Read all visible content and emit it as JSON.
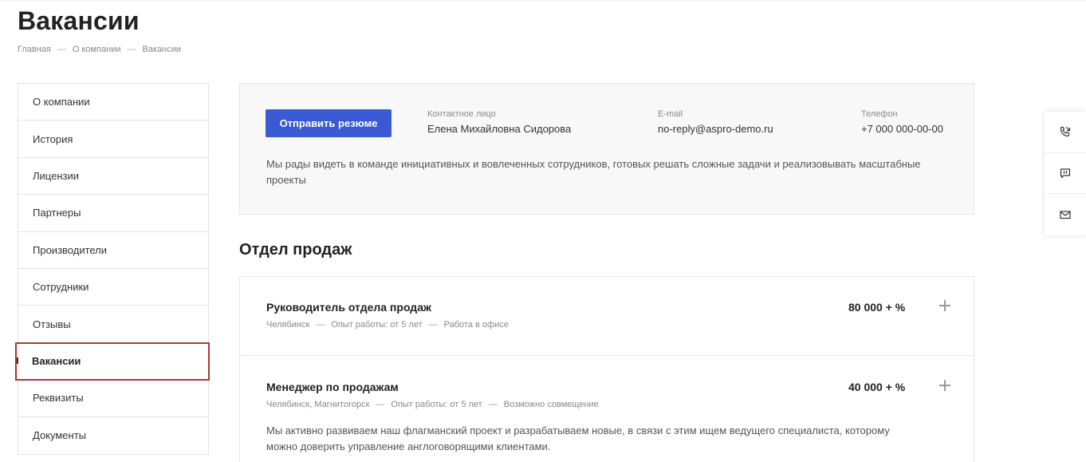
{
  "page": {
    "title": "Вакансии"
  },
  "breadcrumb": [
    {
      "label": "Главная"
    },
    {
      "label": "О компании"
    },
    {
      "label": "Вакансии"
    }
  ],
  "breadcrumb_separator": "—",
  "sidebar": {
    "items": [
      {
        "label": "О компании"
      },
      {
        "label": "История"
      },
      {
        "label": "Лицензии"
      },
      {
        "label": "Партнеры"
      },
      {
        "label": "Производители"
      },
      {
        "label": "Сотрудники"
      },
      {
        "label": "Отзывы"
      },
      {
        "label": "Вакансии",
        "active": true
      },
      {
        "label": "Реквизиты"
      },
      {
        "label": "Документы"
      }
    ]
  },
  "contact": {
    "send_button": "Отправить резюме",
    "person_label": "Контактное лицо",
    "person_value": "Елена Михайловна Сидорова",
    "email_label": "E-mail",
    "email_value": "no-reply@aspro-demo.ru",
    "phone_label": "Телефон",
    "phone_value": "+7 000 000-00-00",
    "description": "Мы рады видеть в команде инициативных и вовлеченных сотрудников, готовых решать сложные задачи и реализовывать масштабные проекты"
  },
  "section": {
    "title": "Отдел продаж"
  },
  "vacancies": [
    {
      "title": "Руководитель отдела продаж",
      "salary": "80 000 + %",
      "meta": [
        "Челябинск",
        "Опыт работы: от 5 лет",
        "Работа в офисе"
      ]
    },
    {
      "title": "Менеджер по продажам",
      "salary": "40 000 + %",
      "meta": [
        "Челябинск, Магнитогорск",
        "Опыт работы: от 5 лет",
        "Возможно совмещение"
      ],
      "description": "Мы активно развиваем наш флагманский проект и разрабатываем новые, в связи с этим ищем ведущего специалиста, которому можно доверить управление англоговорящими клиентами."
    }
  ],
  "icons": {
    "float": [
      "phone-callback-icon",
      "chat-icon",
      "mail-icon"
    ],
    "accent_color": "#3a5ad3",
    "active_outline_color": "#a33a3a"
  }
}
